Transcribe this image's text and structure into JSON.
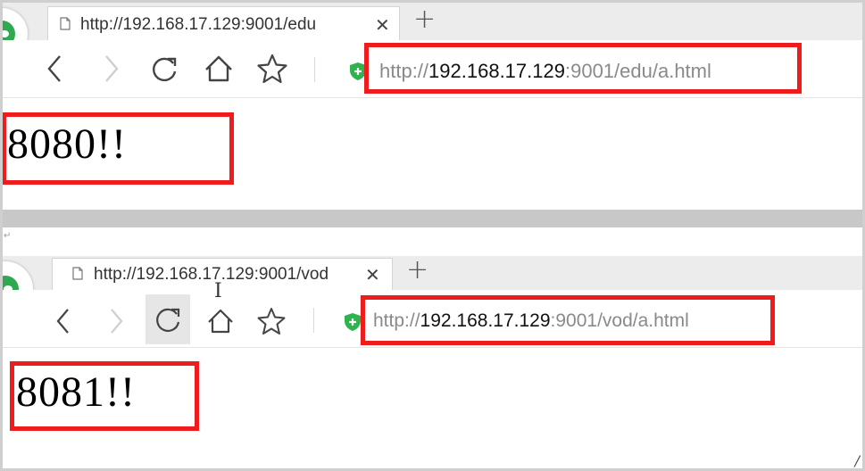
{
  "windows": [
    {
      "tab": {
        "title": "http://192.168.17.129:9001/edu",
        "close_glyph": "✕"
      },
      "new_tab_glyph": "+",
      "address": {
        "scheme": "http://",
        "host": "192.168.17.129",
        "rest": ":9001/edu/a.html"
      },
      "page_text": "8080!!"
    },
    {
      "tab": {
        "title": "http://192.168.17.129:9001/vod",
        "close_glyph": "✕"
      },
      "new_tab_glyph": "+",
      "address": {
        "scheme": "http://",
        "host": "192.168.17.129",
        "rest": ":9001/vod/a.html"
      },
      "page_text": "8081!!"
    }
  ],
  "icons": [
    "browser-logo-icon",
    "page-icon",
    "back-arrow-icon",
    "forward-arrow-icon",
    "refresh-icon",
    "home-icon",
    "star-icon",
    "shield-icon",
    "close-icon",
    "plus-icon",
    "text-cursor-icon"
  ],
  "colors": {
    "highlight": "#ee1c1c",
    "shield": "#2fb34f",
    "logo": "#2fa84f"
  }
}
